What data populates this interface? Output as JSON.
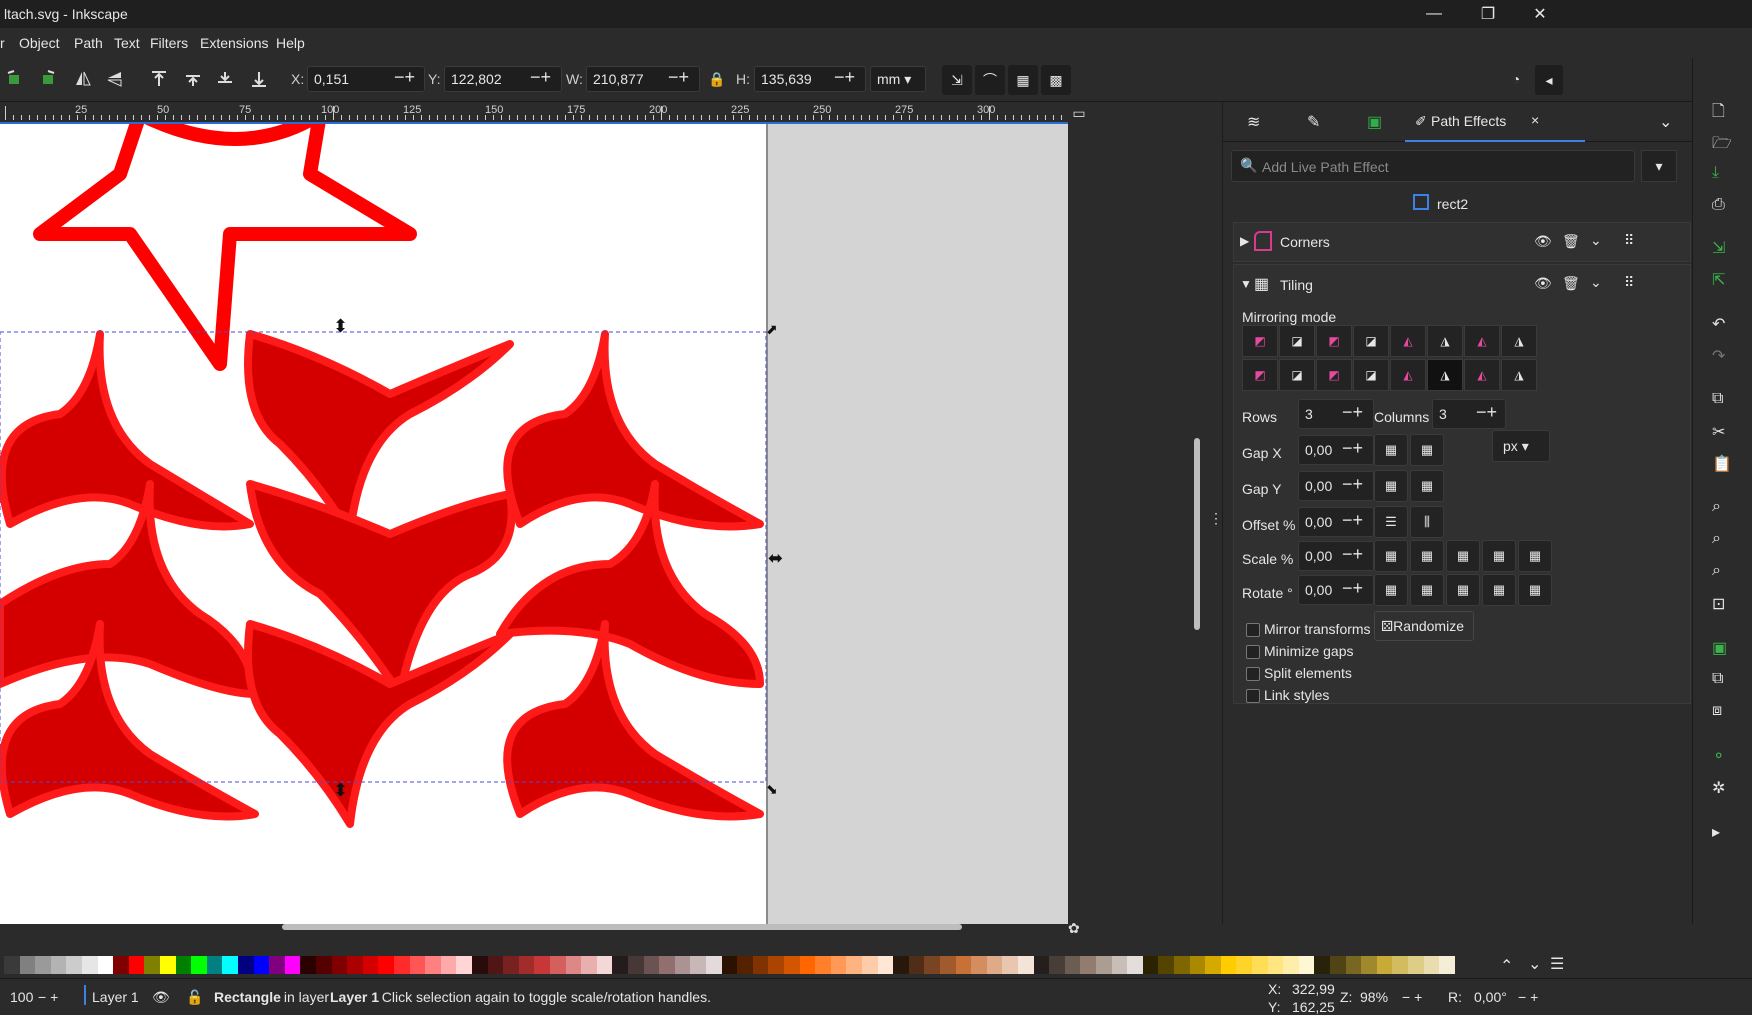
{
  "window": {
    "title": "ltach.svg - Inkscape",
    "minimize": "—",
    "restore": "❐",
    "close": "✕"
  },
  "menu": [
    "r",
    "Object",
    "Path",
    "Text",
    "Filters",
    "Extensions",
    "Help"
  ],
  "toolbar": {
    "x_label": "X:",
    "x_value": "0,151",
    "y_label": "Y:",
    "y_value": "122,802",
    "w_label": "W:",
    "w_value": "210,877",
    "h_label": "H:",
    "h_value": "135,639",
    "unit": "mm"
  },
  "ruler": {
    "labels": [
      "25",
      "50",
      "75",
      "100",
      "125",
      "150",
      "175",
      "200",
      "225",
      "250",
      "275",
      "300"
    ]
  },
  "dialog": {
    "tab_label": "Path Effects",
    "search_placeholder": "Add Live Path Effect",
    "object_name": "rect2",
    "effects": [
      {
        "name": "Corners"
      },
      {
        "name": "Tiling"
      }
    ],
    "mirroring_label": "Mirroring mode",
    "rows_label": "Rows",
    "rows_value": "3",
    "columns_label": "Columns",
    "columns_value": "3",
    "gapx_label": "Gap X",
    "gapx_value": "0,00",
    "gapy_label": "Gap Y",
    "gapy_value": "0,00",
    "offset_label": "Offset %",
    "offset_value": "0,00",
    "scale_label": "Scale %",
    "scale_value": "0,00",
    "rotate_label": "Rotate °",
    "rotate_value": "0,00",
    "unit": "px",
    "checkboxes": [
      "Mirror transforms",
      "Minimize gaps",
      "Split elements",
      "Link styles"
    ],
    "randomize_label": "Randomize"
  },
  "status": {
    "zoom_left": "100",
    "layer": "Layer 1",
    "message_bold": "Rectangle",
    "message_mid": " in layer ",
    "message_layer": "Layer 1",
    "message_tail": ". Click selection again to toggle scale/rotation handles.",
    "x_label": "X:",
    "x_value": "322,99",
    "y_label": "Y:",
    "y_value": "162,25",
    "z_label": "Z:",
    "z_value": "98%",
    "r_label": "R:",
    "r_value": "0,00°"
  },
  "palette": [
    "#3a3a3a",
    "#808080",
    "#9a9a9a",
    "#b3b3b3",
    "#cccccc",
    "#e6e6e6",
    "#ffffff",
    "#800000",
    "#ff0000",
    "#808000",
    "#ffff00",
    "#008000",
    "#00ff00",
    "#008080",
    "#00ffff",
    "#000080",
    "#0000ff",
    "#800080",
    "#ff00ff",
    "#2b0000",
    "#550000",
    "#800000",
    "#aa0000",
    "#d40000",
    "#ff0000",
    "#ff2a2a",
    "#ff5555",
    "#ff8080",
    "#ffaaaa",
    "#ffd5d5",
    "#280b0b",
    "#501616",
    "#782121",
    "#a02c2c",
    "#c83737",
    "#d35f5f",
    "#de8787",
    "#e9afaf",
    "#f4d7d7",
    "#241c1c",
    "#483737",
    "#6c5353",
    "#916f6f",
    "#ac9393",
    "#c8b7b7",
    "#e3dbdb",
    "#2b1100",
    "#552200",
    "#803300",
    "#aa4400",
    "#d45500",
    "#ff6600",
    "#ff7f2a",
    "#ff9955",
    "#ffb380",
    "#ffccaa",
    "#ffe6d5",
    "#28170b",
    "#502d16",
    "#784421",
    "#a05a2c",
    "#c87137",
    "#d38d5f",
    "#deaa87",
    "#e9c6af",
    "#f4e3d7",
    "#241f1c",
    "#483e37",
    "#6c5d53",
    "#917c6f",
    "#ac9d93",
    "#c8beb7",
    "#e3dedb",
    "#2b2200",
    "#554400",
    "#806600",
    "#aa8800",
    "#d4aa00",
    "#ffcc00",
    "#ffd42a",
    "#ffdd55",
    "#ffe680",
    "#ffeeaa",
    "#fff6d5",
    "#28220b",
    "#504416",
    "#786721",
    "#a0892c",
    "#c8ab37",
    "#d3bc5f",
    "#decd87",
    "#e9ddaf",
    "#f4eed7"
  ]
}
